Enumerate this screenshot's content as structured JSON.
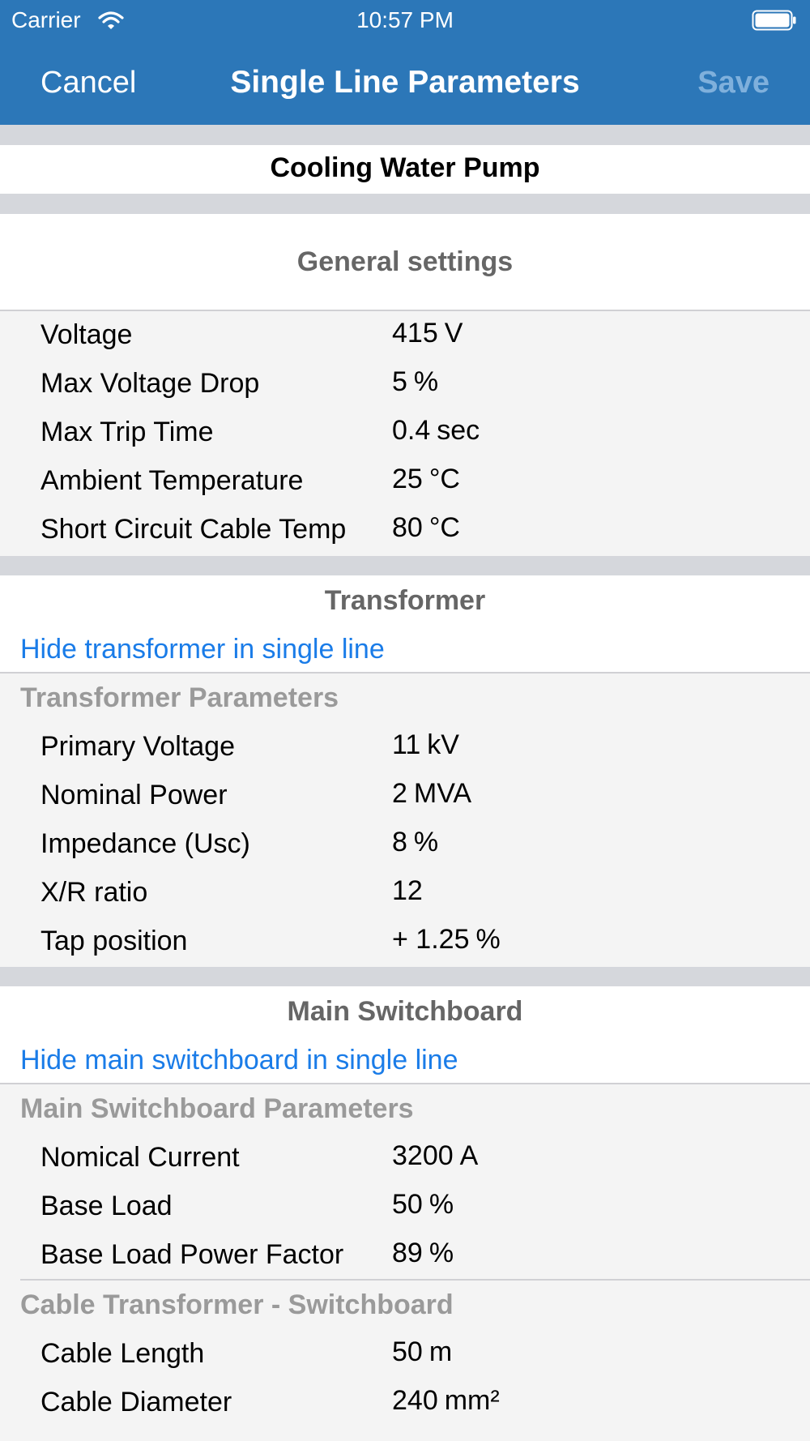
{
  "status_bar": {
    "carrier": "Carrier",
    "time": "10:57 PM"
  },
  "nav": {
    "cancel": "Cancel",
    "title": "Single Line Parameters",
    "save": "Save"
  },
  "item_name": "Cooling Water Pump",
  "general": {
    "title": "General settings",
    "rows": [
      {
        "label": "Voltage",
        "value": "415",
        "unit": "V"
      },
      {
        "label": "Max Voltage Drop",
        "value": "5",
        "unit": "%"
      },
      {
        "label": "Max Trip Time",
        "value": "0.4",
        "unit": "sec"
      },
      {
        "label": "Ambient Temperature",
        "value": "25",
        "unit": "°C"
      },
      {
        "label": "Short Circuit Cable Temp",
        "value": "80",
        "unit": "°C"
      }
    ]
  },
  "transformer": {
    "title": "Transformer",
    "hide_link": "Hide transformer in single line",
    "params_header": "Transformer Parameters",
    "rows": [
      {
        "label": "Primary Voltage",
        "value": "11",
        "unit": "kV"
      },
      {
        "label": "Nominal Power",
        "value": "2",
        "unit": "MVA"
      },
      {
        "label": "Impedance (Usc)",
        "value": "8",
        "unit": "%"
      },
      {
        "label": "X/R ratio",
        "value": "12",
        "unit": ""
      },
      {
        "label": "Tap position",
        "value": "+ 1.25",
        "unit": "%"
      }
    ]
  },
  "main_switchboard": {
    "title": "Main Switchboard",
    "hide_link": "Hide main switchboard in single line",
    "params_header": "Main Switchboard Parameters",
    "rows": [
      {
        "label": "Nomical Current",
        "value": "3200",
        "unit": "A"
      },
      {
        "label": "Base Load",
        "value": "50",
        "unit": "%"
      },
      {
        "label": "Base Load Power Factor",
        "value": "89",
        "unit": "%"
      }
    ],
    "cable_header": "Cable Transformer - Switchboard",
    "cable_rows": [
      {
        "label": "Cable Length",
        "value": "50",
        "unit": "m"
      },
      {
        "label": "Cable Diameter",
        "value": "240",
        "unit": "mm²"
      }
    ]
  }
}
